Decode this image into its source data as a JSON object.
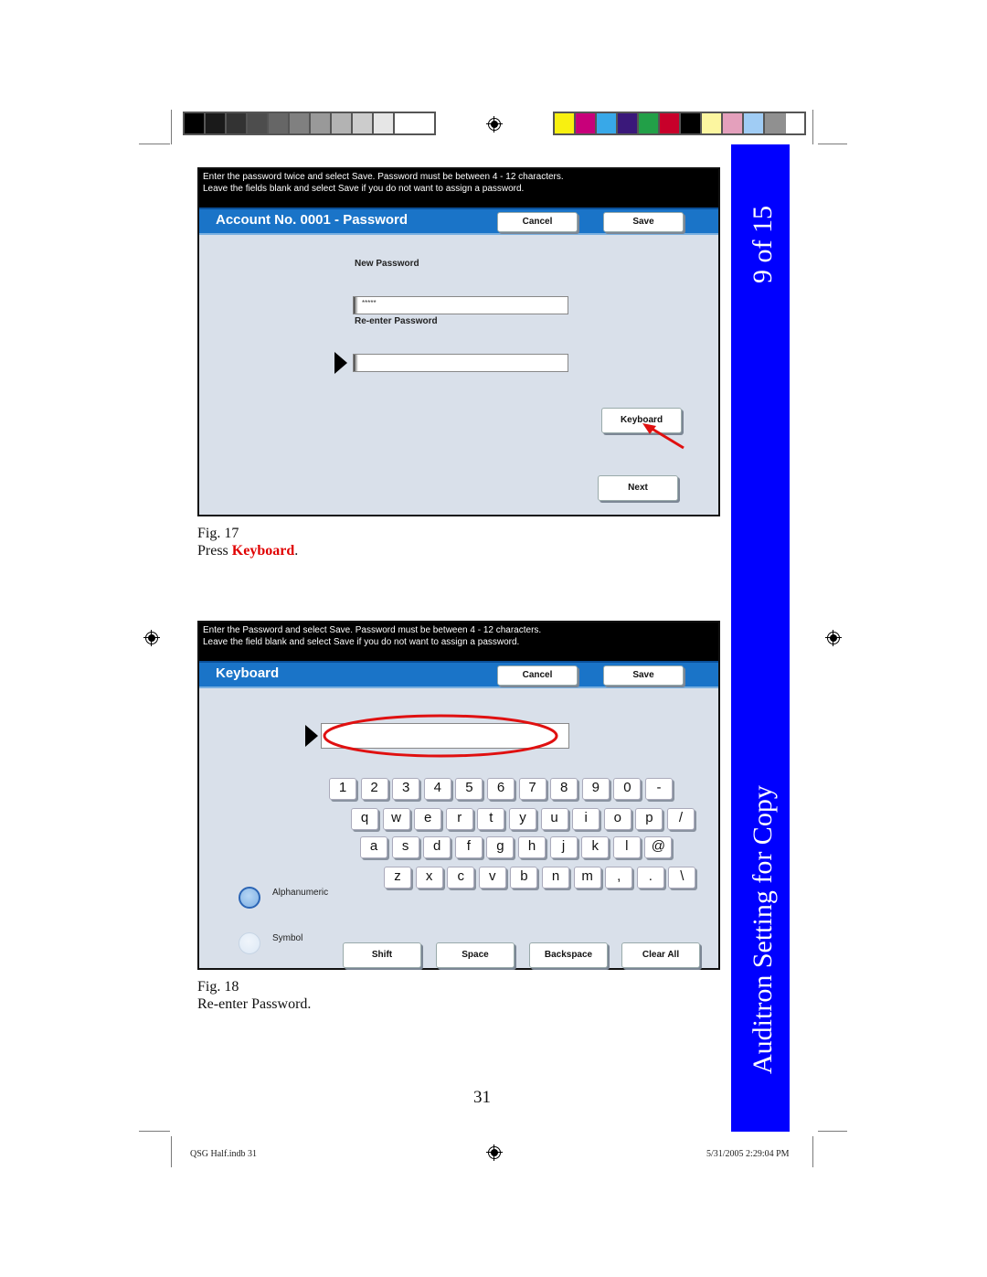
{
  "printer_marks": {
    "grayscale_swatches": [
      "#000000",
      "#1a1a1a",
      "#333333",
      "#4d4d4d",
      "#666666",
      "#808080",
      "#999999",
      "#b3b3b3",
      "#cccccc",
      "#e6e6e6",
      "#ffffff"
    ],
    "color_swatches": [
      "#f8f010",
      "#c8007a",
      "#38a8e8",
      "#3a187a",
      "#22a048",
      "#c8002a",
      "#000000",
      "#fcf6a0",
      "#e4a0bc",
      "#a0ccf4",
      "#909090"
    ]
  },
  "side_tab": {
    "color": "#0000ff",
    "page_progress": "9 of 15",
    "section_title": "Auditron Setting for Copy"
  },
  "fig17": {
    "message_line1": "Enter the password twice and select Save.  Password must be between 4 - 12 characters.",
    "message_line2": "Leave the fields blank and select Save if you do not want to assign a password.",
    "title": "Account No. 0001 - Password",
    "cancel_label": "Cancel",
    "save_label": "Save",
    "new_password_label": "New Password",
    "new_password_value": "*****",
    "reenter_label": "Re-enter Password",
    "reenter_value": "",
    "keyboard_label": "Keyboard",
    "next_label": "Next",
    "caption_fig": "Fig. 17",
    "caption_prefix": "Press ",
    "caption_highlight": "Keyboard",
    "caption_suffix": ".",
    "annotation": "red-arrow pointing to Keyboard button"
  },
  "fig18": {
    "message_line1": "Enter the Password and select Save.  Password must be between 4 - 12 characters.",
    "message_line2": "Leave the field blank and select Save if you do not want to assign a password.",
    "title": "Keyboard",
    "cancel_label": "Cancel",
    "save_label": "Save",
    "input_value": "",
    "annotation": "red ellipse around input field",
    "keys": {
      "row1": [
        "1",
        "2",
        "3",
        "4",
        "5",
        "6",
        "7",
        "8",
        "9",
        "0",
        "-"
      ],
      "row2": [
        "q",
        "w",
        "e",
        "r",
        "t",
        "y",
        "u",
        "i",
        "o",
        "p",
        "/"
      ],
      "row3": [
        "a",
        "s",
        "d",
        "f",
        "g",
        "h",
        "j",
        "k",
        "l",
        "@"
      ],
      "row4": [
        "z",
        "x",
        "c",
        "v",
        "b",
        "n",
        "m",
        ",",
        ".",
        "\\"
      ]
    },
    "modes": [
      {
        "label": "Alphanumeric",
        "selected": true
      },
      {
        "label": "Symbol",
        "selected": false
      }
    ],
    "shift_label": "Shift",
    "space_label": "Space",
    "backspace_label": "Backspace",
    "clear_all_label": "Clear All",
    "caption_fig": "Fig. 18",
    "caption_text": "Re-enter Password."
  },
  "footer": {
    "page_number": "31",
    "slug_left": "QSG Half.indb   31",
    "slug_right": "5/31/2005   2:29:04 PM"
  }
}
